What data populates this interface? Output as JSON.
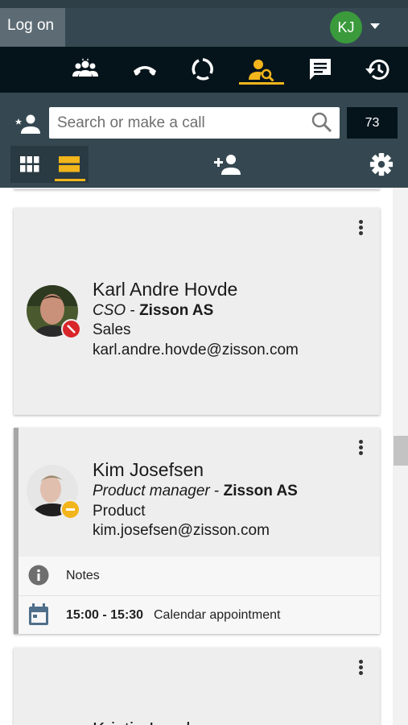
{
  "header": {
    "logon_label": "Log on",
    "user_initials": "KJ",
    "user_avatar_color": "#3a9a3c"
  },
  "nav": {
    "items": [
      {
        "icon": "group-icon",
        "active": false
      },
      {
        "icon": "phone-hangup-icon",
        "active": false
      },
      {
        "icon": "circle-sync-icon",
        "active": false
      },
      {
        "icon": "person-search-icon",
        "active": true
      },
      {
        "icon": "chat-icon",
        "active": false
      },
      {
        "icon": "history-icon",
        "active": false
      }
    ],
    "active_color": "#f2b51b"
  },
  "search": {
    "placeholder": "Search or make a call",
    "count": "73"
  },
  "toolbar": {
    "view_mode": "list"
  },
  "contacts": [
    {
      "name": "Karl Andre Hovde",
      "title": "CSO",
      "separator": " - ",
      "company": "Zisson AS",
      "department": "Sales",
      "email": "karl.andre.hovde@zisson.com",
      "status": "do-not-disturb",
      "status_color": "#d9262b"
    },
    {
      "name": "Kim Josefsen",
      "title": "Product manager",
      "separator": " - ",
      "company": "Zisson AS",
      "department": "Product",
      "email": "kim.josefsen@zisson.com",
      "status": "away",
      "status_color": "#f2b51b",
      "notes_label": "Notes",
      "calendar_time": "15:00 - 15:30",
      "calendar_label": "Calendar appointment"
    },
    {
      "name_partial": "Kristin Lund"
    }
  ]
}
